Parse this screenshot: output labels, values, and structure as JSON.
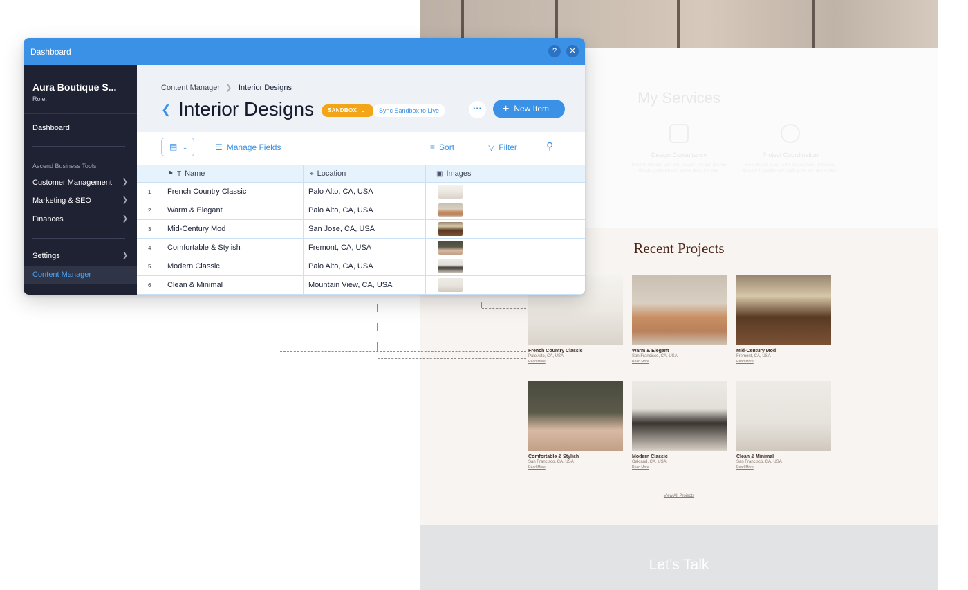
{
  "website": {
    "services": {
      "title": "My Services",
      "items": [
        {
          "name": "Design Consultancy",
          "desc": "Refer to manage your own project? We can provide design, guidance and advice along the way."
        },
        {
          "name": "Project Coordination",
          "desc": "From design plans to the actual phase of the way through installation and styling, we are here to help."
        }
      ]
    },
    "projects": {
      "title": "Recent Projects",
      "cards": [
        {
          "name": "French Country Classic",
          "location": "Palo Alto, CA, USA",
          "link": "Read More"
        },
        {
          "name": "Warm & Elegant",
          "location": "San Francisco, CA, USA",
          "link": "Read More"
        },
        {
          "name": "Mid-Century Mod",
          "location": "Fremont, CA, USA",
          "link": "Read More"
        },
        {
          "name": "Comfortable & Stylish",
          "location": "San Francisco, CA, USA",
          "link": "Read More"
        },
        {
          "name": "Modern Classic",
          "location": "Oakland, CA, USA",
          "link": "Read More"
        },
        {
          "name": "Clean & Minimal",
          "location": "San Francisco, CA, USA",
          "link": "Read More"
        }
      ],
      "view_all": "View All Projects"
    },
    "talk": {
      "title": "Let’s Talk"
    }
  },
  "dashboard": {
    "window_title": "Dashboard",
    "help_icon": "?",
    "close_icon": "✕",
    "sidebar": {
      "site_name": "Aura Boutique S...",
      "role": "Role:",
      "dashboard": "Dashboard",
      "section_label": "Ascend Business Tools",
      "items": [
        {
          "label": "Customer Management"
        },
        {
          "label": "Marketing & SEO"
        },
        {
          "label": "Finances"
        }
      ],
      "settings": "Settings",
      "active": "Content Manager"
    },
    "header": {
      "breadcrumb_root": "Content Manager",
      "breadcrumb_current": "Interior Designs",
      "title": "Interior Designs",
      "badge": "SANDBOX",
      "sync": "Sync Sandbox to Live",
      "more": "···",
      "new_item": "New Item"
    },
    "toolbar": {
      "manage_fields": "Manage Fields",
      "sort": "Sort",
      "filter": "Filter"
    },
    "table": {
      "columns": [
        "Name",
        "Location",
        "Images"
      ],
      "rows": [
        {
          "num": "1",
          "name": "French Country Classic",
          "location": "Palo Alto, CA, USA"
        },
        {
          "num": "2",
          "name": "Warm & Elegant",
          "location": "Palo Alto, CA, USA"
        },
        {
          "num": "3",
          "name": "Mid-Century Mod",
          "location": "San Jose, CA, USA"
        },
        {
          "num": "4",
          "name": "Comfortable & Stylish",
          "location": "Fremont, CA, USA"
        },
        {
          "num": "5",
          "name": "Modern Classic",
          "location": "Palo Alto, CA, USA"
        },
        {
          "num": "6",
          "name": "Clean & Minimal",
          "location": "Mountain View, CA, USA"
        }
      ]
    }
  },
  "colors": {
    "accent": "#3b91e6",
    "sidebar": "#1f2233",
    "badge": "#f2a517",
    "projects_title": "#4a2418"
  }
}
